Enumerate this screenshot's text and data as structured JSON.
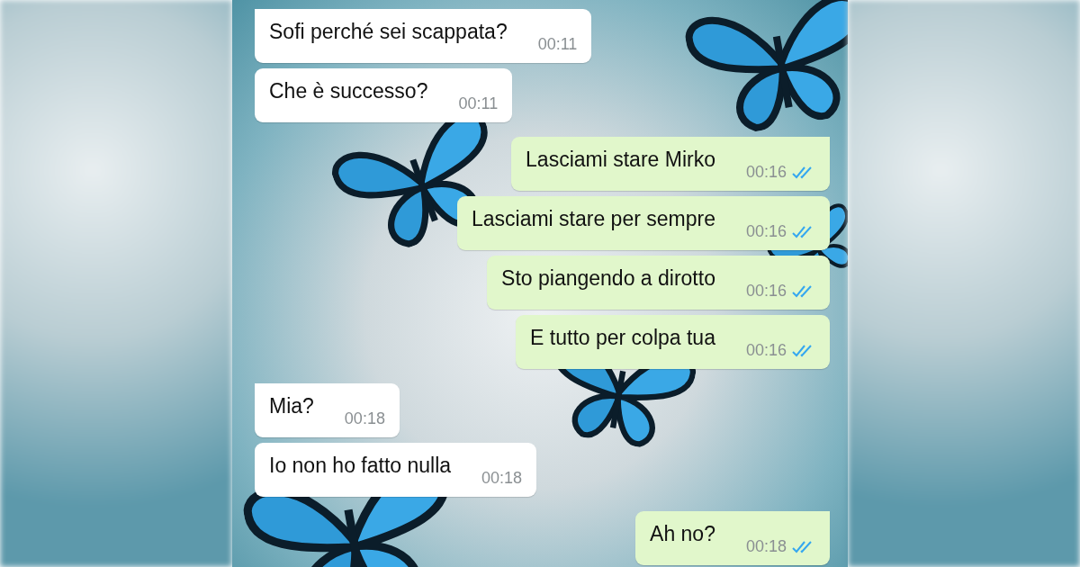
{
  "messages": [
    {
      "kind": "incoming",
      "text": "Sofi perché sei scappata?",
      "time": "00:11",
      "first": true
    },
    {
      "kind": "incoming",
      "text": "Che è successo?",
      "time": "00:11",
      "first": false
    },
    {
      "kind": "outgoing",
      "text": "Lasciami stare Mirko",
      "time": "00:16",
      "first": true,
      "read": true
    },
    {
      "kind": "outgoing",
      "text": "Lasciami stare per sempre",
      "time": "00:16",
      "first": false,
      "read": true
    },
    {
      "kind": "outgoing",
      "text": "Sto piangendo a dirotto",
      "time": "00:16",
      "first": false,
      "read": true
    },
    {
      "kind": "outgoing",
      "text": "E tutto per colpa tua",
      "time": "00:16",
      "first": false,
      "read": true
    },
    {
      "kind": "incoming",
      "text": "Mia?",
      "time": "00:18",
      "first": true
    },
    {
      "kind": "incoming",
      "text": "Io non ho fatto nulla",
      "time": "00:18",
      "first": false
    },
    {
      "kind": "outgoing",
      "text": "Ah no?",
      "time": "00:18",
      "first": true,
      "read": true
    }
  ]
}
